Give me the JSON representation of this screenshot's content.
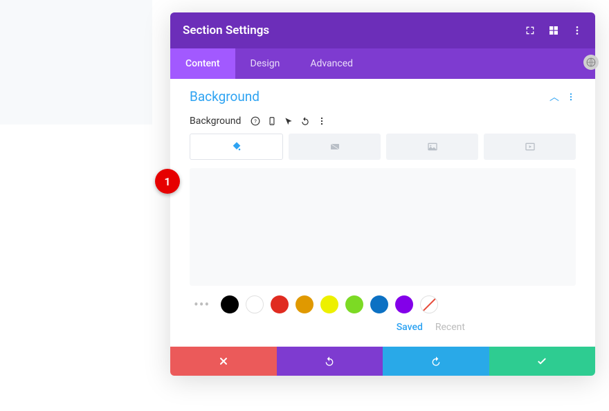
{
  "header": {
    "title": "Section Settings"
  },
  "tabs": [
    {
      "label": "Content",
      "active": true
    },
    {
      "label": "Design",
      "active": false
    },
    {
      "label": "Advanced",
      "active": false
    }
  ],
  "section": {
    "title": "Background",
    "field_label": "Background"
  },
  "bg_type_tabs": [
    {
      "name": "color",
      "active": true
    },
    {
      "name": "gradient",
      "active": false
    },
    {
      "name": "image",
      "active": false
    },
    {
      "name": "video",
      "active": false
    }
  ],
  "swatches": [
    {
      "name": "black",
      "color": "#000000"
    },
    {
      "name": "white",
      "color": "#ffffff"
    },
    {
      "name": "red",
      "color": "#e02b20"
    },
    {
      "name": "orange",
      "color": "#e09900"
    },
    {
      "name": "yellow",
      "color": "#edf000"
    },
    {
      "name": "green",
      "color": "#7cda24"
    },
    {
      "name": "blue",
      "color": "#0c71c3"
    },
    {
      "name": "purple",
      "color": "#8300e9"
    },
    {
      "name": "none",
      "color": "none"
    }
  ],
  "palette_links": {
    "saved": "Saved",
    "recent": "Recent"
  },
  "annotation": {
    "number": "1"
  }
}
